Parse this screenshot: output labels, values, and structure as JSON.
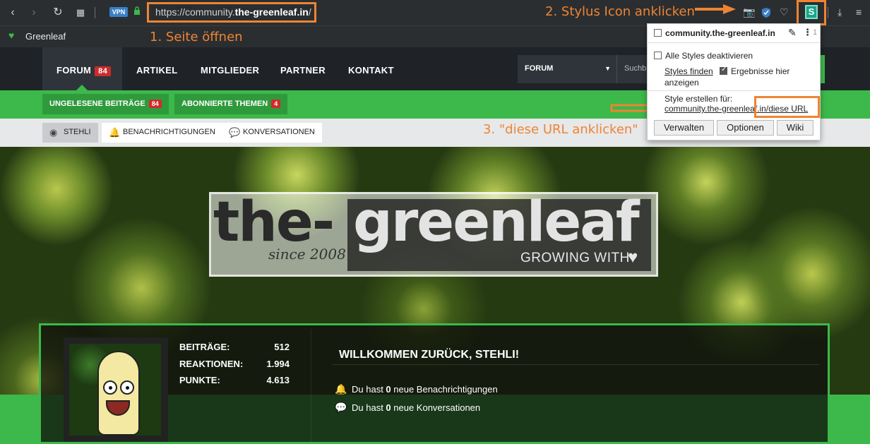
{
  "browser": {
    "url_prefix": "https://community.",
    "url_domain": "the-greenleaf.in",
    "url_suffix": "/",
    "vpn_label": "VPN",
    "bookmark_label": "Greenleaf"
  },
  "annotations": {
    "step1": "1. Seite öffnen",
    "step2": "2. Stylus Icon anklicken",
    "step3": "3. \"diese URL anklicken\""
  },
  "stylus_icon_letter": "S",
  "site_nav": {
    "forum": "FORUM",
    "forum_badge": "84",
    "artikel": "ARTIKEL",
    "mitglieder": "MITGLIEDER",
    "partner": "PARTNER",
    "kontakt": "KONTAKT",
    "search_scope": "FORUM",
    "search_placeholder": "Suchb"
  },
  "green_bar": {
    "unread_label": "UNGELESENE BEITRÄGE",
    "unread_badge": "84",
    "subscribed_label": "ABONNIERTE THEMEN",
    "subscribed_badge": "4"
  },
  "user_bar": {
    "user": "STEHLI",
    "notifications": "BENACHRICHTIGUNGEN",
    "conversations": "KONVERSATIONEN"
  },
  "logo": {
    "the": "the-",
    "greenleaf": "greenleaf",
    "since": "since 2008",
    "growing": "GROWING WITH"
  },
  "welcome": {
    "stats": [
      {
        "label": "BEITRÄGE:",
        "value": "512"
      },
      {
        "label": "REAKTIONEN:",
        "value": "1.994"
      },
      {
        "label": "PUNKTE:",
        "value": "4.613"
      }
    ],
    "title": "WILLKOMMEN ZURÜCK, STEHLI!",
    "notif_pre": "Du hast ",
    "notif_count": "0",
    "notif_post": " neue Benachrichtigungen",
    "conv_pre": "Du hast ",
    "conv_count": "0",
    "conv_post": " neue Konversationen"
  },
  "popup": {
    "site": "community.the-greenleaf.in",
    "count": "1",
    "disable_all": "Alle Styles deaktivieren",
    "find_styles": "Styles finden",
    "show_results": "Ergebnisse hier",
    "show_results_2": "anzeigen",
    "create_for": "Style erstellen für:",
    "create_link_domain": "community.the-greenleaf.in",
    "create_link_this_url": "/diese URL",
    "btn_manage": "Verwalten",
    "btn_options": "Optionen",
    "btn_wiki": "Wiki"
  },
  "colors": {
    "accent_orange": "#ee8433",
    "brand_green": "#3cb94a",
    "badge_red": "#d02b2b"
  }
}
